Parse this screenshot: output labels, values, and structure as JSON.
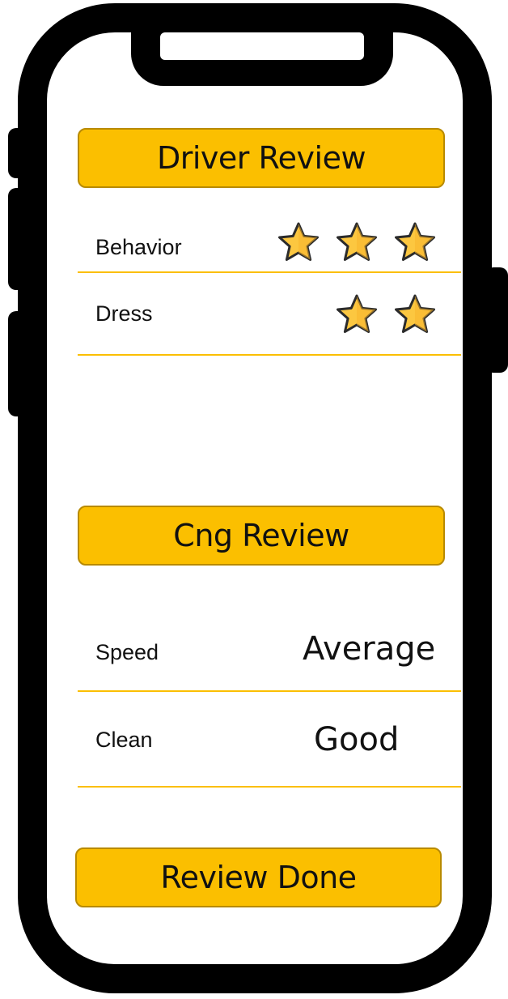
{
  "driver_review": {
    "title": "Driver Review",
    "rows": [
      {
        "label": "Behavior",
        "stars": 3
      },
      {
        "label": "Dress",
        "stars": 2
      }
    ]
  },
  "cng_review": {
    "title": "Cng Review",
    "rows": [
      {
        "label": "Speed",
        "value": "Average"
      },
      {
        "label": "Clean",
        "value": "Good"
      }
    ]
  },
  "actions": {
    "review_done_label": "Review Done"
  },
  "colors": {
    "accent": "#FBBF00",
    "star_fill": "#FCC740",
    "star_outline": "#2B2B2B"
  },
  "icons": {
    "rating": "star-icon"
  }
}
